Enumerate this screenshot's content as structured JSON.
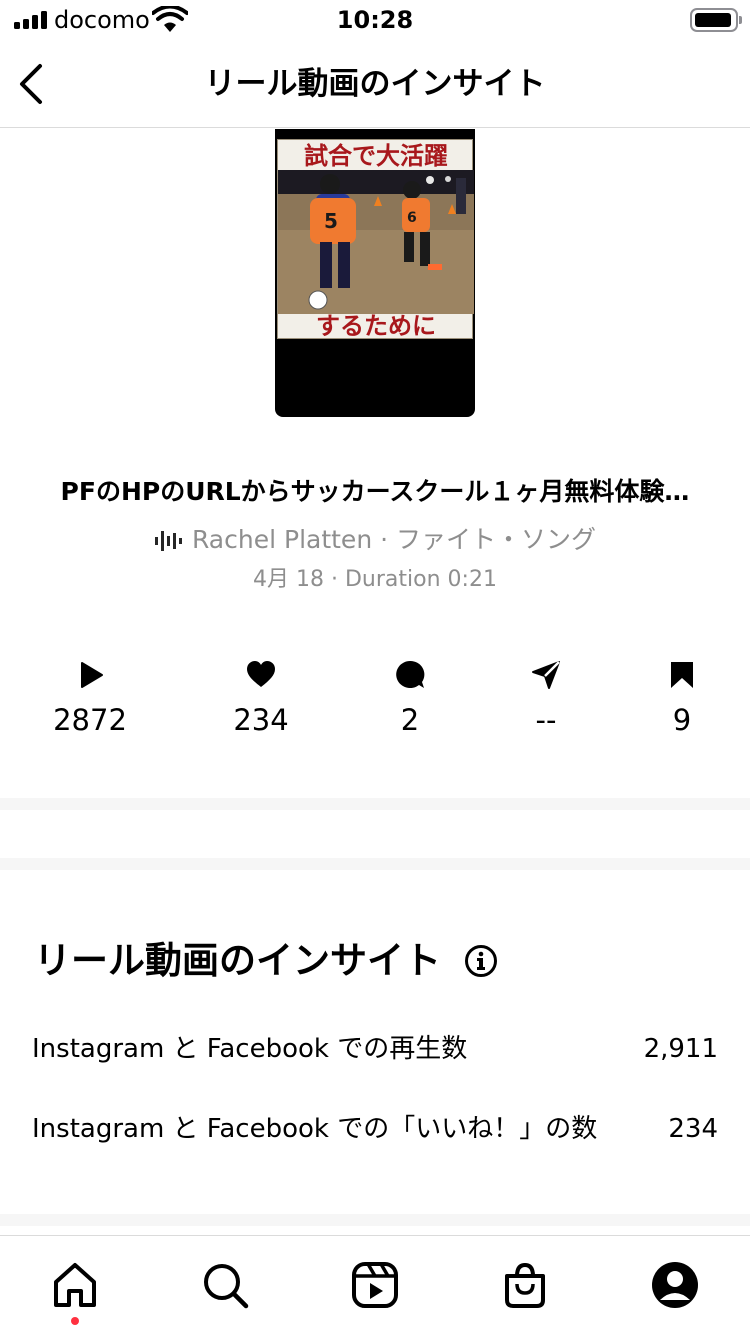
{
  "status_bar": {
    "carrier": "docomo",
    "time": "10:28",
    "signal_bars": 4,
    "battery_level": 0.85
  },
  "header": {
    "title": "リール動画のインサイト",
    "back_icon": "chevron-left-icon"
  },
  "reel": {
    "thumbnail_top_text": "試合で大活躍",
    "thumbnail_bottom_text": "するために",
    "caption": "PFのHPのURLからサッカースクール１ヶ月無料体験…",
    "audio": "Rachel Platten · ファイト・ソング",
    "audio_icon": "audio-wave-icon",
    "date_duration": "4月 18 · Duration 0:21"
  },
  "stats": [
    {
      "icon": "play-icon",
      "value": "2872"
    },
    {
      "icon": "heart-icon",
      "value": "234"
    },
    {
      "icon": "comment-icon",
      "value": "2"
    },
    {
      "icon": "share-icon",
      "value": "--"
    },
    {
      "icon": "bookmark-icon",
      "value": "9"
    }
  ],
  "insights": {
    "title": "リール動画のインサイト",
    "info_icon": "info-icon",
    "metrics": [
      {
        "label": "Instagram と Facebook での再生数",
        "value": "2,911"
      },
      {
        "label": "Instagram と Facebook での「いいね！」の数",
        "value": "234"
      }
    ]
  },
  "tab_bar": {
    "tabs": [
      "home-icon",
      "search-icon",
      "reels-icon",
      "shop-icon",
      "profile-icon"
    ],
    "notification_dot_color": "#ff3040"
  }
}
